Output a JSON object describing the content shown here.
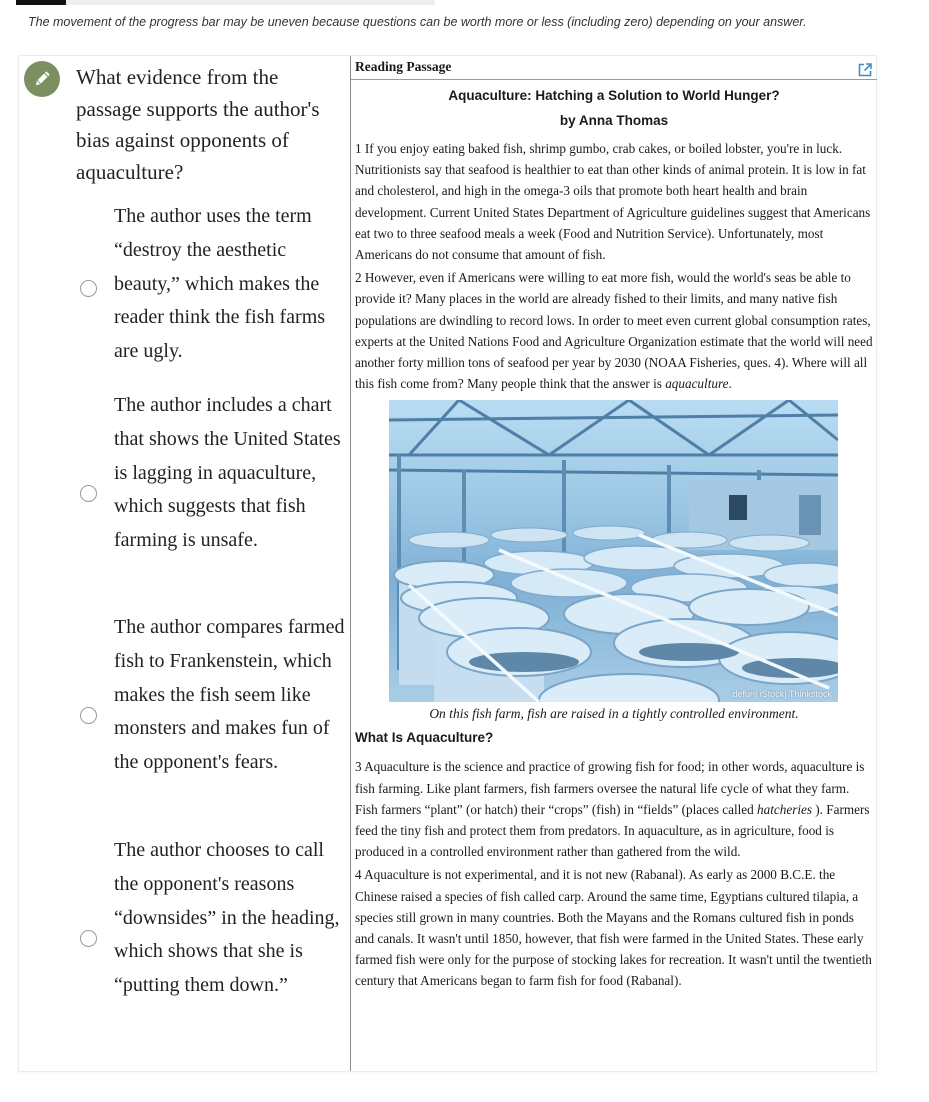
{
  "progress": {
    "fraction_complete": 0.12
  },
  "notice": "The movement of the progress bar may be uneven because questions can be worth more or less (including zero) depending on your answer.",
  "question": {
    "icon": "pencil-icon",
    "text": "What evidence from the passage supports the author's bias against opponents of aquaculture?",
    "options": [
      {
        "text": "The author uses the term “destroy the aesthetic beauty,” which makes the reader think the fish farms are ugly.",
        "selected": false
      },
      {
        "text": "The author includes a chart that shows the United States is lagging in aquaculture, which suggests that fish farming is unsafe.",
        "selected": false
      },
      {
        "text": "The author compares farmed fish to Frankenstein, which makes the fish seem like monsters and makes fun of the opponent's fears.",
        "selected": false
      },
      {
        "text": "The author chooses to call the opponent's reasons “downsides” in the heading, which shows that she is “putting them down.”",
        "selected": false
      }
    ]
  },
  "passage": {
    "label": "Reading Passage",
    "popout_icon": "external-link-icon",
    "title": "Aquaculture: Hatching a Solution to World Hunger?",
    "author": "by Anna Thomas",
    "paragraphs_before_figure": [
      {
        "text": "1 If you enjoy eating baked fish, shrimp gumbo, crab cakes, or boiled lobster, you're in luck. Nutritionists say that seafood is healthier to eat than other kinds of animal protein. It is low in fat and cholesterol, and high in the omega-3 oils that promote both heart health and brain development. Current United States Department of Agriculture guidelines suggest that Americans eat two to three seafood meals a week (Food and Nutrition Service). Unfortunately, most Americans do not consume that amount of fish."
      },
      {
        "text": "2 However, even if Americans were willing to eat more fish, would the world's seas be able to provide it? Many places in the world are already fished to their limits, and many native fish populations are dwindling to record lows. In order to meet even current global consumption rates, experts at the United Nations Food and Agriculture Organization estimate that the world will need another forty million tons of seafood per year by 2030 (NOAA Fisheries, ques. 4). Where will all this fish come from? Many people think that the answer is ",
        "emphasis": "aquaculture",
        "after": "."
      }
    ],
    "figure": {
      "alt": "Rows of round fish-farming tanks under a metal-frame greenhouse roof",
      "credit": "defun| iStock| Thinkstock",
      "caption": "On this fish farm, fish are raised in a tightly controlled environment."
    },
    "section_heading": "What Is Aquaculture?",
    "paragraphs_after_figure": [
      {
        "before": "3 Aquaculture is the science and practice of growing fish for food; in other words, aquaculture is fish farming. Like plant farmers, fish farmers oversee the natural life cycle of what they farm. Fish farmers “plant” (or hatch) their “crops” (fish) in “fields” (places called ",
        "emphasis": "hatcheries",
        "after": " ). Farmers feed the tiny fish and protect them from predators. In aquaculture, as in agriculture, food is produced in a controlled environment rather than gathered from the wild."
      },
      {
        "before": "4 Aquaculture is not experimental, and it is not new (Rabanal). As early as 2000 B.C.E. the Chinese raised a species of fish called carp. Around the same time, Egyptians cultured tilapia, a species still grown in many countries. Both the Mayans and the Romans cultured fish in ponds and canals. It wasn't until 1850, however, that fish were farmed in the United States. These early farmed fish were only for the purpose of stocking lakes for recreation. It wasn't until the twentieth century that Americans began to farm fish for food (Rabanal).",
        "emphasis": "",
        "after": ""
      }
    ]
  },
  "colors": {
    "pencil_badge": "#7c8f60",
    "progress_fill": "#111111",
    "popout_icon": "#3d8fc4"
  }
}
